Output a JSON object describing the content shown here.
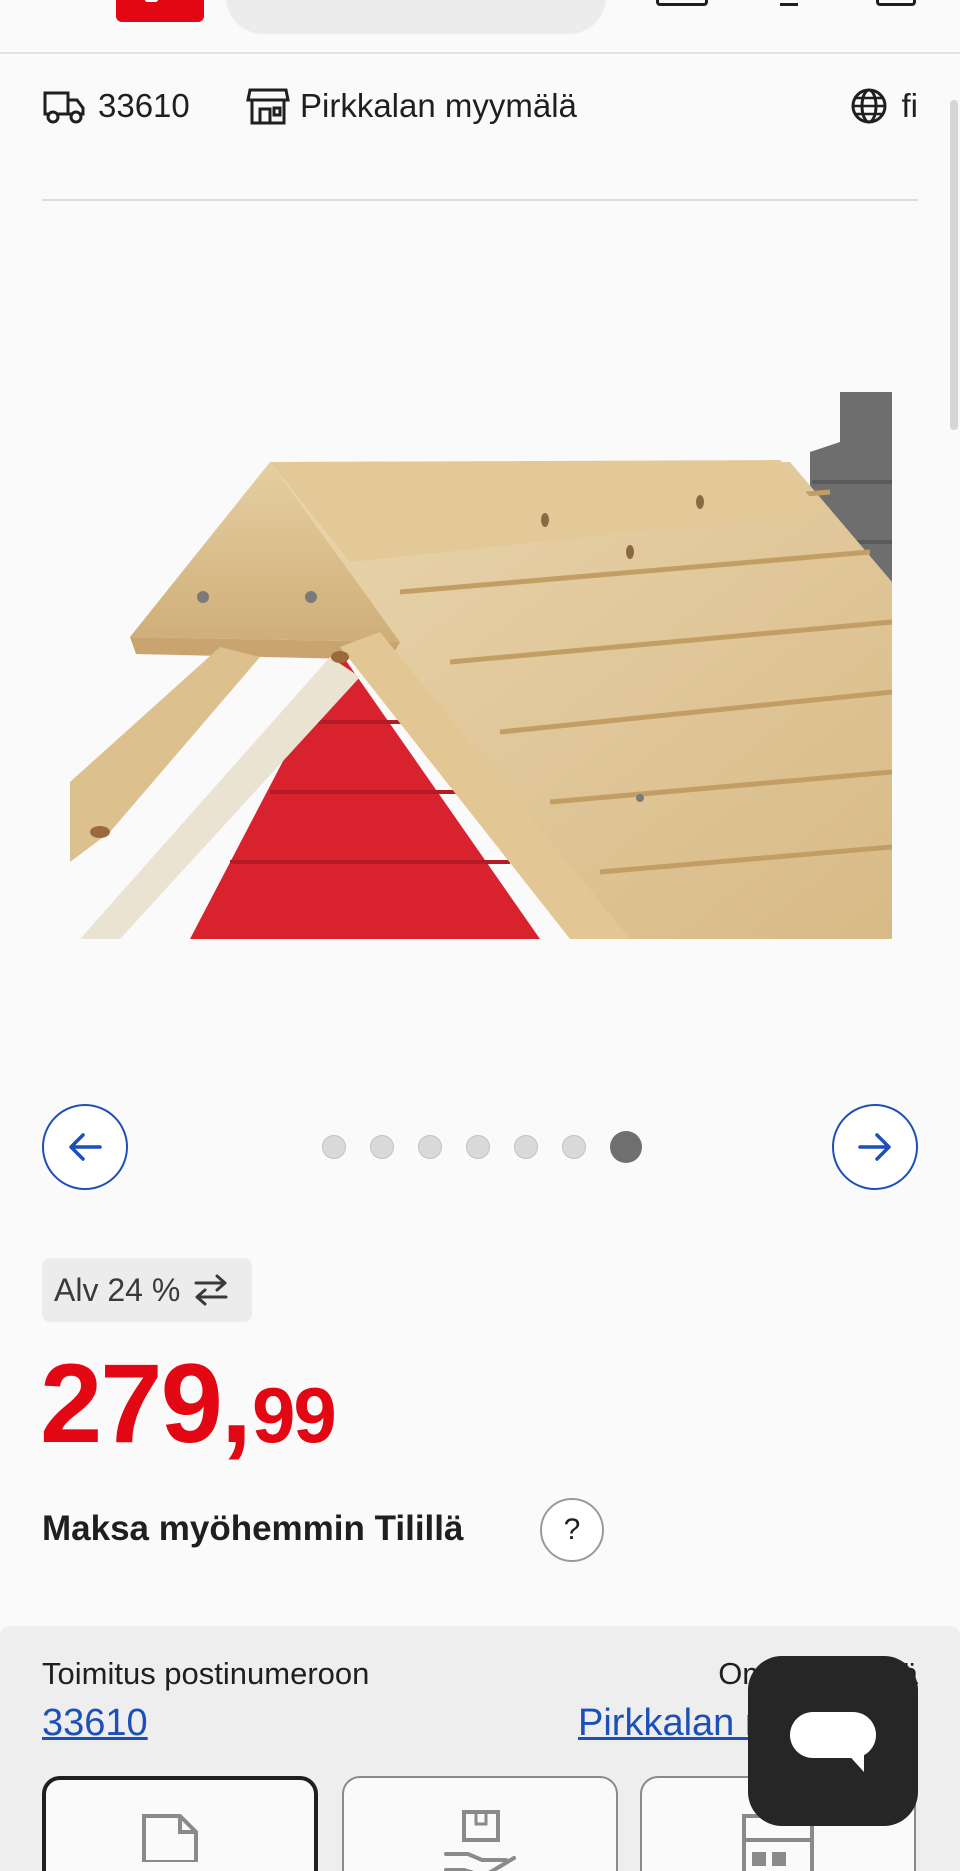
{
  "header": {
    "menu_icon": "hamburger-icon",
    "logo_icon": "store-logo",
    "search_icon": "search-icon"
  },
  "info_bar": {
    "postal_code": "33610",
    "store": "Pirkkalan myymälä",
    "language": "fi",
    "icons": [
      "delivery-truck-icon",
      "store-icon",
      "globe-icon"
    ]
  },
  "carousel": {
    "image_count": 7,
    "active_index": 7,
    "prev_icon": "arrow-left-icon",
    "next_icon": "arrow-right-icon"
  },
  "vat": {
    "label": "Alv 24 %",
    "icon": "swap-arrows-icon"
  },
  "price": {
    "integer": "279,",
    "decimals": "99"
  },
  "pay_later": {
    "label": "Maksa myöhemmin Tilillä",
    "help": "?"
  },
  "delivery": {
    "delivery_label": "Toimitus postinumeroon",
    "delivery_value": "33610",
    "store_label": "Oma myymälä",
    "store_value": "Pirkkalan myymälä",
    "options": [
      "delivery-box-icon",
      "pickup-hand-icon",
      "store-shelf-icon"
    ]
  },
  "chat": {
    "icon": "chat-icon"
  },
  "colors": {
    "brand_red": "#e30613",
    "link_blue": "#1d4fb8",
    "text": "#1f1f1f"
  }
}
